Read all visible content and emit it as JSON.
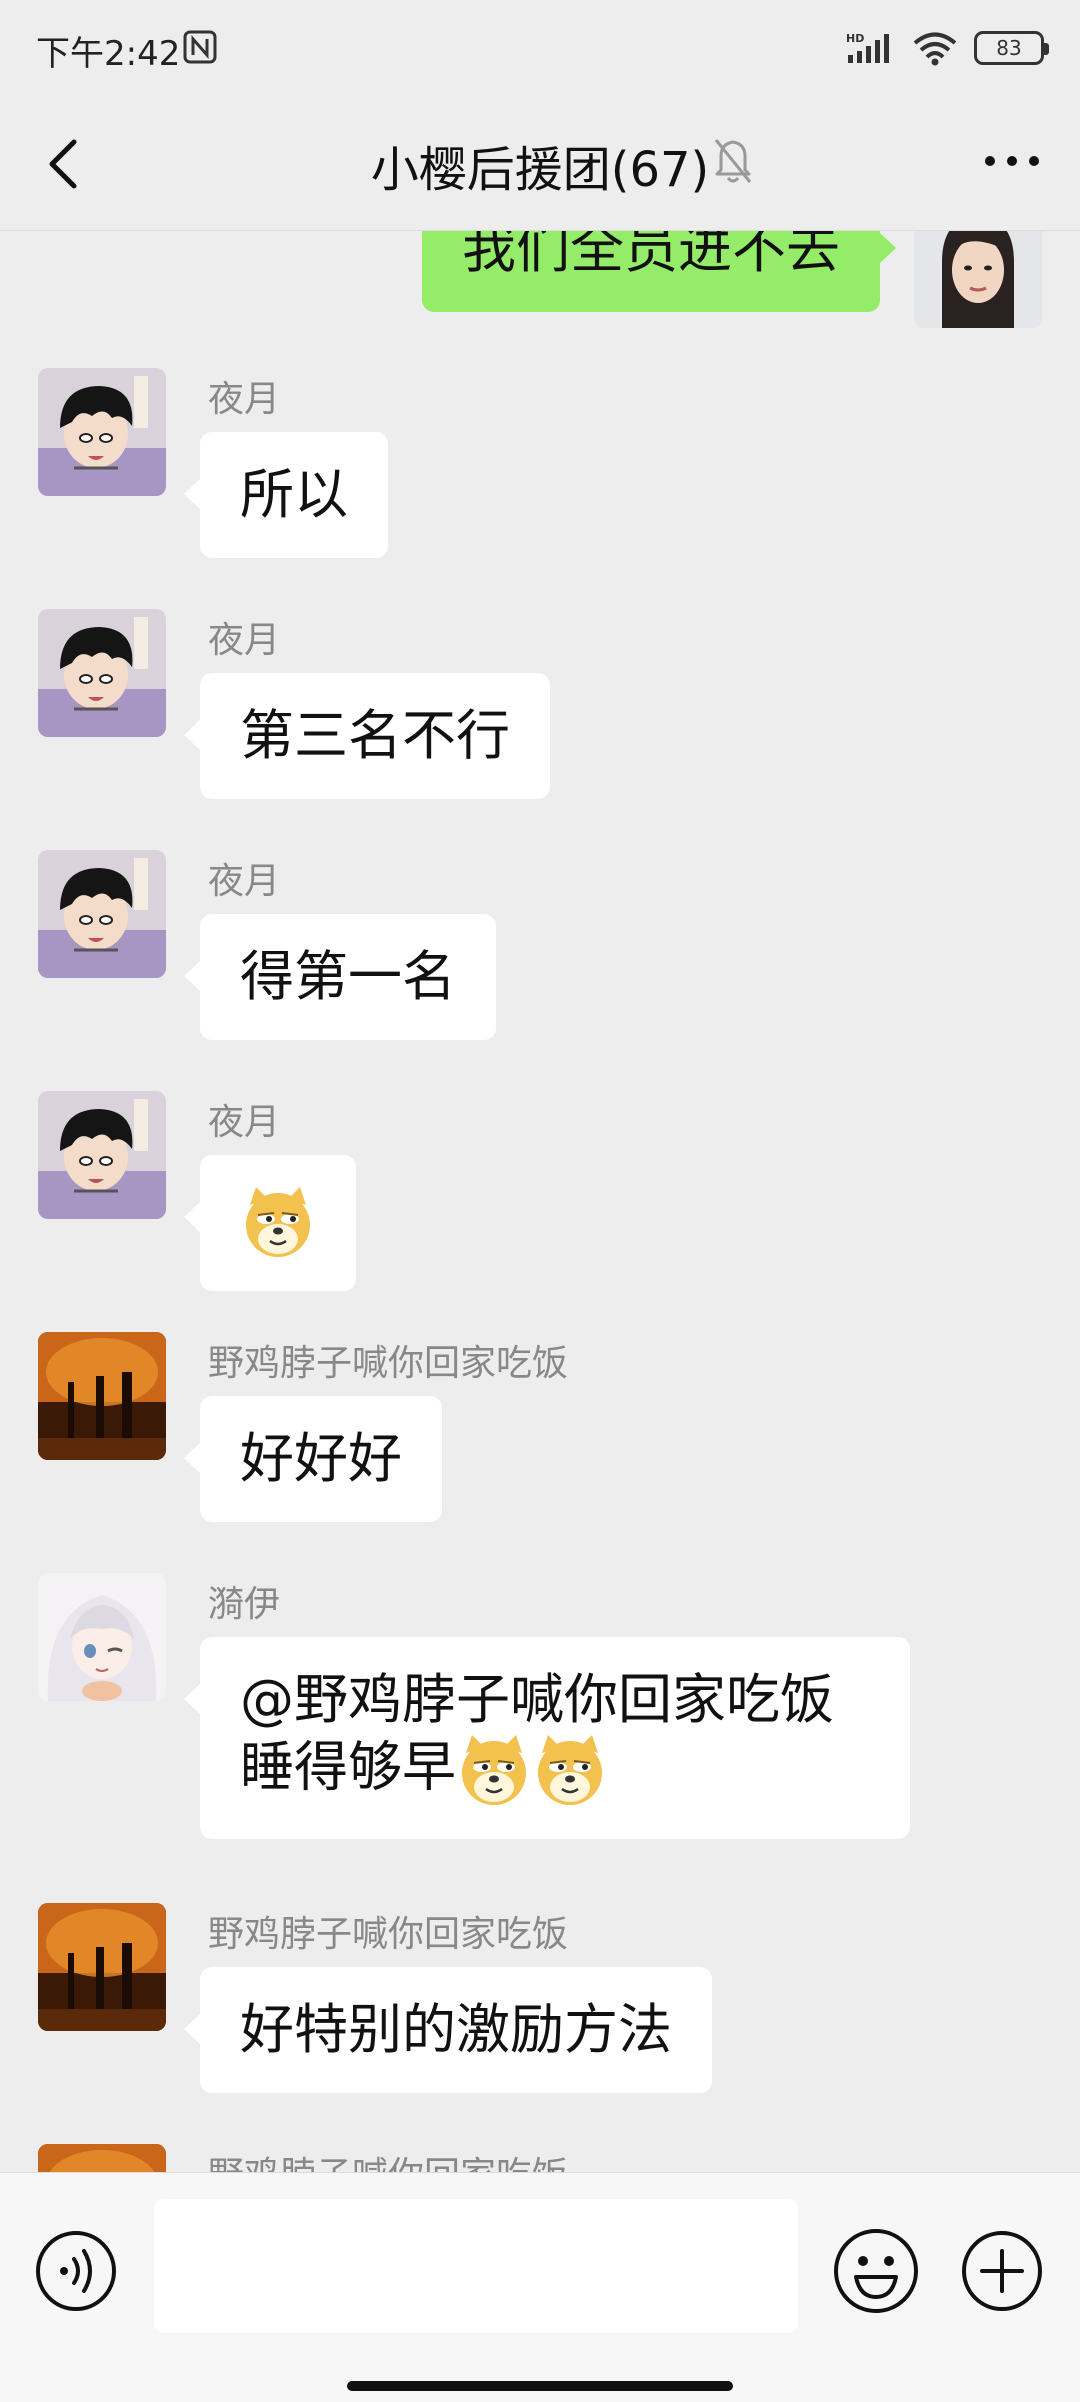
{
  "status_bar": {
    "time": "下午2:42",
    "battery": "83",
    "network": "HD"
  },
  "header": {
    "title": "小樱后援团(67)"
  },
  "messages": [
    {
      "sender": "",
      "text": "我们全员进不去",
      "self": true
    },
    {
      "sender": "夜月",
      "text": "所以"
    },
    {
      "sender": "夜月",
      "text": "第三名不行"
    },
    {
      "sender": "夜月",
      "text": "得第一名"
    },
    {
      "sender": "夜月",
      "text": "",
      "emoji": "doge-emoji"
    },
    {
      "sender": "野鸡脖子喊你回家吃饭",
      "text": "好好好"
    },
    {
      "sender": "漪伊",
      "line1": "@野鸡脖子喊你回家吃饭",
      "line2": "睡得够早",
      "emoji": "doge-emoji"
    },
    {
      "sender": "野鸡脖子喊你回家吃饭",
      "text": "好特别的激励方法"
    },
    {
      "sender": "野鸡脖子喊你回家吃饭"
    }
  ],
  "colors": {
    "self_bubble": "#95ec69",
    "other_bubble": "#ffffff",
    "background": "#ededed"
  }
}
